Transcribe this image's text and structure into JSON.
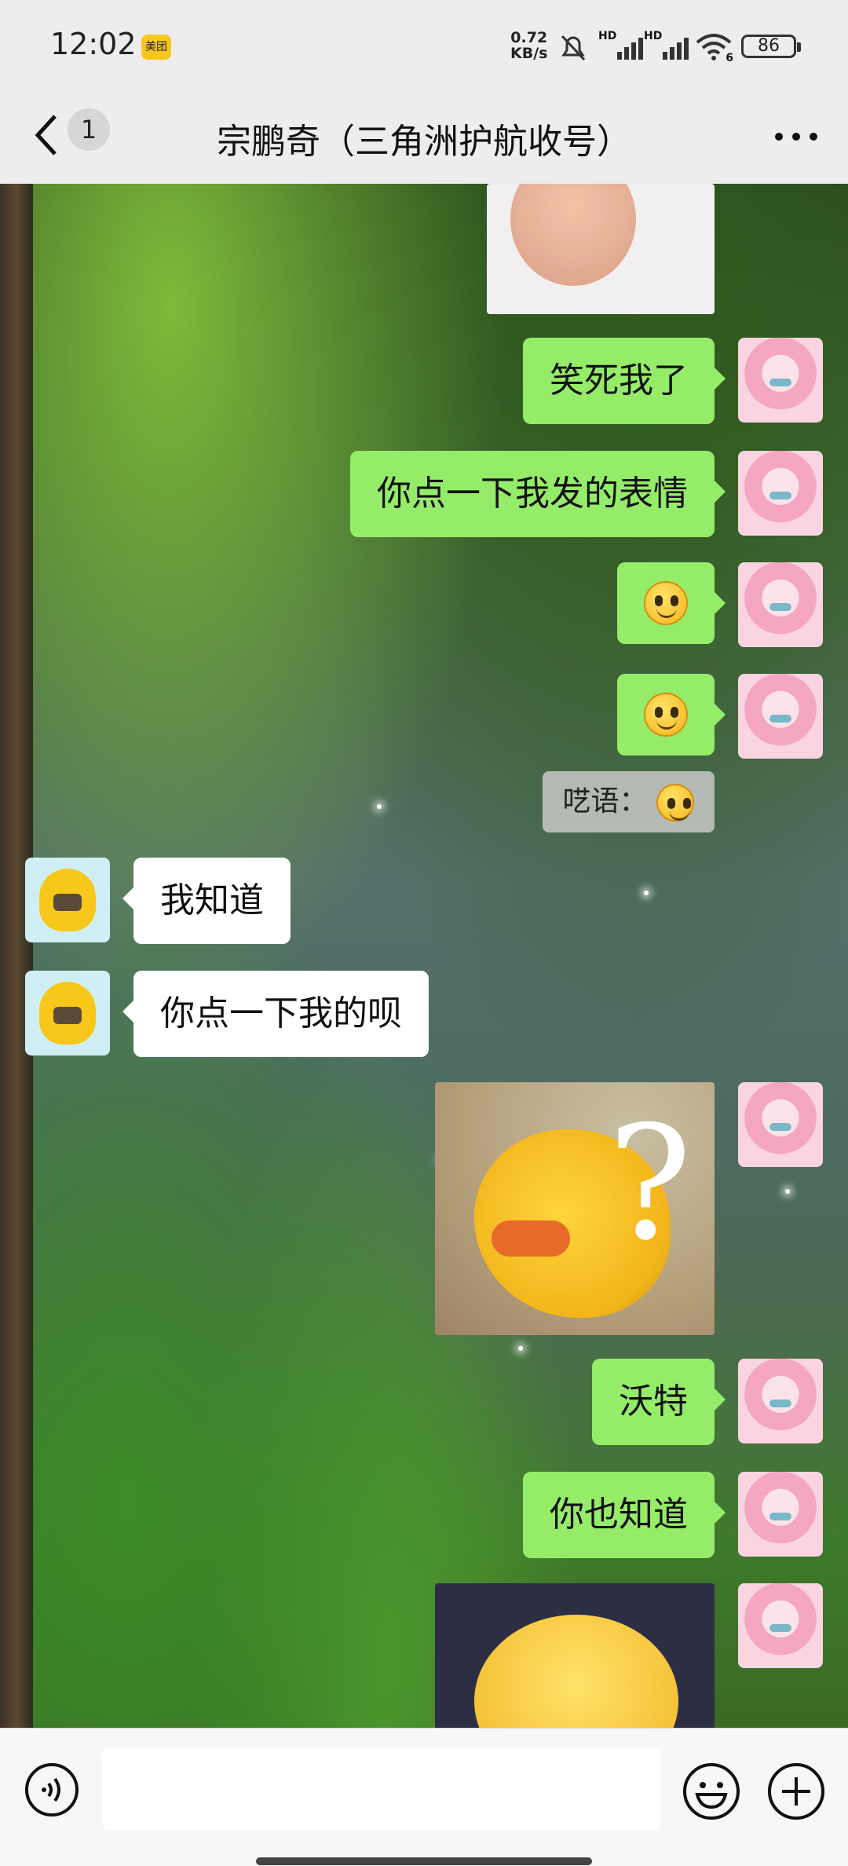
{
  "status_bar": {
    "time": "12:02",
    "app_badge": "美团",
    "net_speed_value": "0.72",
    "net_speed_unit": "KB/s",
    "signal_1_label": "HD",
    "signal_2_label": "HD",
    "wifi_label": "6",
    "battery": "86"
  },
  "header": {
    "unread_count": "1",
    "title": "宗鹏奇（三角洲护航收号）"
  },
  "messages": {
    "m1": "笑死我了",
    "m2": "你点一下我发的表情",
    "m3_emoji": "smiley-emoji",
    "m4_emoji": "smiley-emoji",
    "quote_prefix": "呓语：",
    "m5": "我知道",
    "m6": "你点一下我的呗",
    "m7": "沃特",
    "m8": "你也知道"
  },
  "icons": {
    "back": "back-chevron-icon",
    "more": "more-dots-icon",
    "voice": "voice-input-icon",
    "emoji": "emoji-icon",
    "plus": "plus-icon"
  },
  "colors": {
    "bubble_me": "#95ec69",
    "bubble_other": "#ffffff",
    "app_badge": "#f7c81a"
  }
}
